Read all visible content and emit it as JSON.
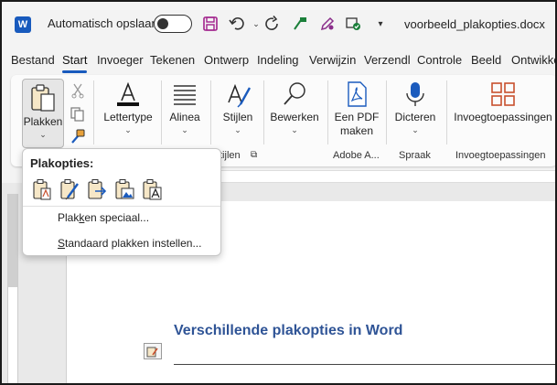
{
  "titlebar": {
    "app_icon_letter": "W",
    "autosave_label": "Automatisch opslaan",
    "autosave_state": "off",
    "document_title": "voorbeeld_plakopties.docx",
    "accent_color": "#185abd"
  },
  "tabs": [
    {
      "label": "Bestand"
    },
    {
      "label": "Start",
      "active": true
    },
    {
      "label": "Invoeger"
    },
    {
      "label": "Tekenen"
    },
    {
      "label": "Ontwerp"
    },
    {
      "label": "Indeling"
    },
    {
      "label": "Verwijzin"
    },
    {
      "label": "Verzendl"
    },
    {
      "label": "Controle"
    },
    {
      "label": "Beeld"
    },
    {
      "label": "Ontwikke"
    }
  ],
  "ribbon": {
    "plakken": {
      "label": "Plakken"
    },
    "lettertype": {
      "label": "Lettertype"
    },
    "alinea": {
      "label": "Alinea"
    },
    "stijlen": {
      "label": "Stijlen",
      "group_label_partial": "tijlen"
    },
    "bewerken": {
      "label": "Bewerken"
    },
    "pdf": {
      "label_line1": "Een PDF",
      "label_line2": "maken",
      "group_label": "Adobe A..."
    },
    "dicteren": {
      "label": "Dicteren",
      "group_label": "Spraak"
    },
    "invoeg": {
      "label": "Invoegtoepassingen",
      "group_label": "Invoegtoepassingen"
    }
  },
  "dropdown": {
    "title": "Plakopties:",
    "options": [
      {
        "icon": "keep-source-formatting-icon"
      },
      {
        "icon": "merge-formatting-icon"
      },
      {
        "icon": "paste-link-icon"
      },
      {
        "icon": "paste-picture-icon"
      },
      {
        "icon": "keep-text-only-icon"
      }
    ],
    "item_special_pre": "Plak",
    "item_special_ul": "k",
    "item_special_post": "en speciaal...",
    "item_default_ul": "S",
    "item_default_post": "tandaard plakken instellen..."
  },
  "document": {
    "heading": "Verschillende plakopties in Word",
    "heading_color": "#2f5496"
  }
}
